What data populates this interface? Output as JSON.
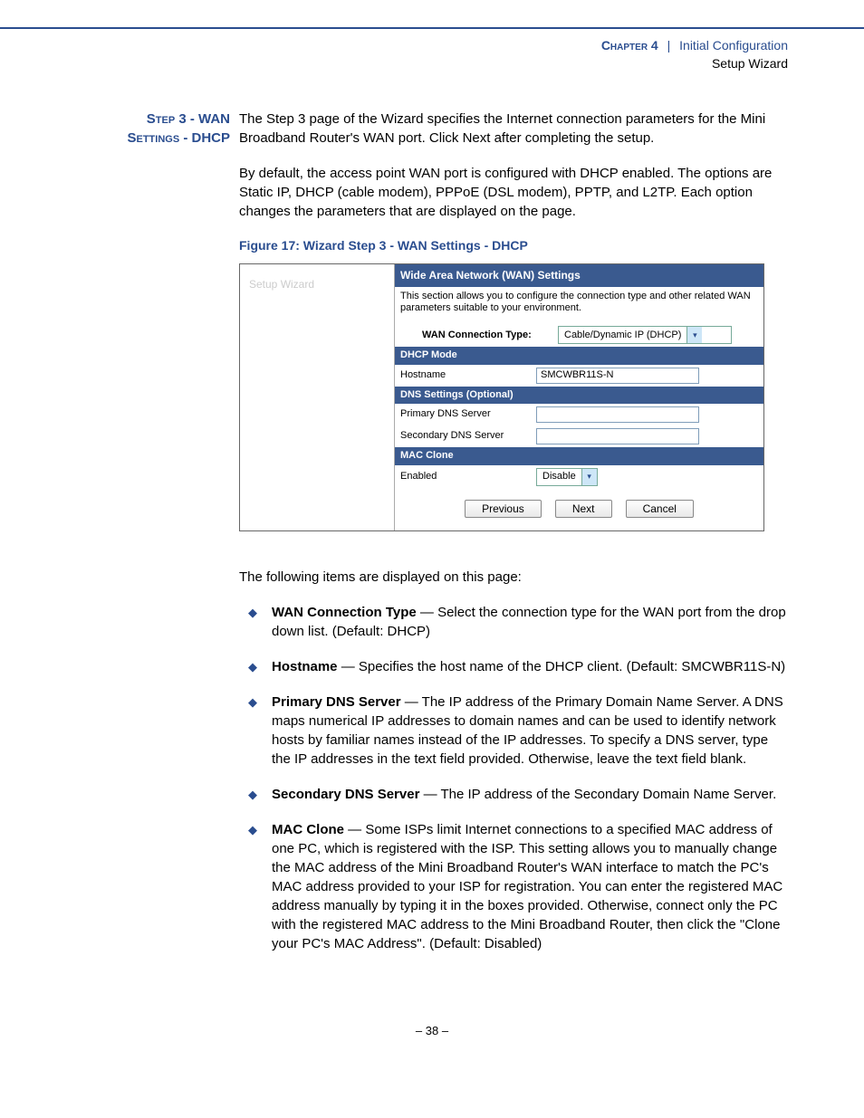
{
  "header": {
    "chapter_label": "Chapter 4",
    "separator": "|",
    "section": "Initial Configuration",
    "subsection": "Setup Wizard"
  },
  "side_heading": {
    "line1": "Step 3 - WAN",
    "line2": "Settings - DHCP"
  },
  "intro": {
    "p1": "The Step 3 page of the Wizard specifies the Internet connection parameters for the Mini Broadband Router's WAN port. Click Next after completing the setup.",
    "p2": "By default, the access point WAN port is configured with DHCP enabled. The options are Static IP, DHCP (cable modem), PPPoE (DSL modem), PPTP, and L2TP. Each option changes the parameters that are displayed on the page."
  },
  "figure_caption": "Figure 17:  Wizard Step 3 - WAN Settings - DHCP",
  "figure": {
    "sidebar_label": "Setup Wizard",
    "panel_title": "Wide Area Network (WAN) Settings",
    "panel_desc": "This section allows you to configure the connection type and other related WAN parameters suitable to your environment.",
    "conn_type_label": "WAN Connection Type:",
    "conn_type_value": "Cable/Dynamic IP (DHCP)",
    "dhcp_mode_bar": "DHCP Mode",
    "hostname_label": "Hostname",
    "hostname_value": "SMCWBR11S-N",
    "dns_bar": "DNS Settings (Optional)",
    "primary_dns_label": "Primary DNS Server",
    "secondary_dns_label": "Secondary DNS Server",
    "mac_clone_bar": "MAC Clone",
    "enabled_label": "Enabled",
    "enabled_value": "Disable",
    "btn_previous": "Previous",
    "btn_next": "Next",
    "btn_cancel": "Cancel"
  },
  "post_figure_intro": "The following items are displayed on this page:",
  "items": [
    {
      "term": "WAN Connection Type",
      "desc": " — Select the connection type for the WAN port from the drop down list. (Default: DHCP)"
    },
    {
      "term": "Hostname",
      "desc": " — Specifies the host name of the DHCP client. (Default: SMCWBR11S-N)"
    },
    {
      "term": "Primary DNS Server",
      "desc": " — The IP address of the Primary Domain Name Server. A DNS maps numerical IP addresses to domain names and can be used to identify network hosts by familiar names instead of the IP addresses. To specify a DNS server, type the IP addresses in the text field provided. Otherwise, leave the text field blank."
    },
    {
      "term": "Secondary DNS Server",
      "desc": " — The IP address of the Secondary Domain Name Server."
    },
    {
      "term": "MAC Clone",
      "desc": " — Some ISPs limit Internet connections to a specified MAC address of one PC, which is registered with the ISP. This setting allows you to manually change the MAC address of the Mini Broadband Router's WAN interface to match the PC's MAC address provided to your ISP for registration. You can enter the registered MAC address manually by typing it in the boxes provided. Otherwise, connect only the PC with the registered MAC address to the Mini Broadband Router, then click the \"Clone your PC's MAC Address\". (Default: Disabled)"
    }
  ],
  "page_number": "–  38  –"
}
